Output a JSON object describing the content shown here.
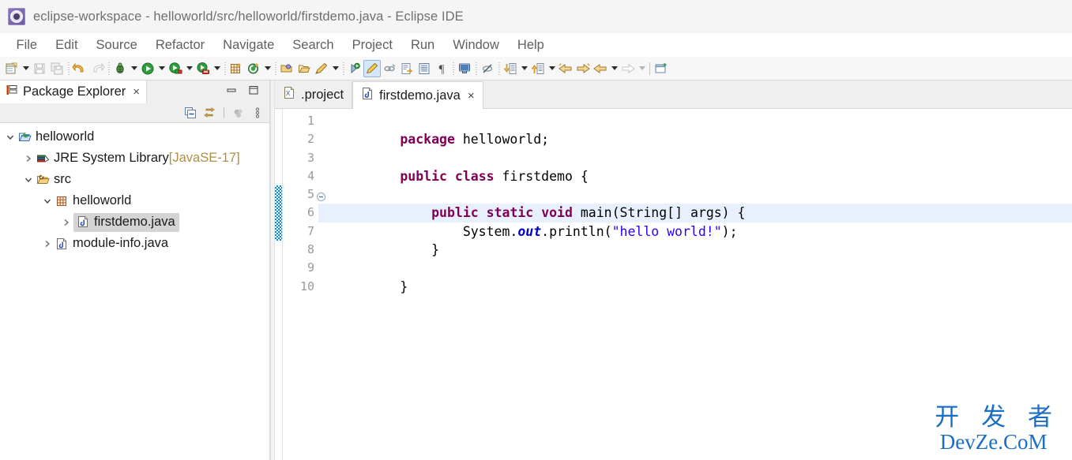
{
  "window": {
    "title": "eclipse-workspace - helloworld/src/helloworld/firstdemo.java - Eclipse IDE",
    "app_icon": "eclipse-icon"
  },
  "menubar": {
    "items": [
      {
        "label": "File"
      },
      {
        "label": "Edit"
      },
      {
        "label": "Source"
      },
      {
        "label": "Refactor"
      },
      {
        "label": "Navigate"
      },
      {
        "label": "Search"
      },
      {
        "label": "Project"
      },
      {
        "label": "Run"
      },
      {
        "label": "Window"
      },
      {
        "label": "Help"
      }
    ]
  },
  "toolbar": {
    "items": [
      {
        "icon": "new-wizard-icon"
      },
      {
        "icon": "dropdown-arrow-icon"
      },
      {
        "icon": "save-icon"
      },
      {
        "icon": "save-all-icon"
      },
      {
        "icon": "separator"
      },
      {
        "icon": "undo-icon"
      },
      {
        "icon": "redo-icon"
      },
      {
        "icon": "separator"
      },
      {
        "icon": "debug-icon"
      },
      {
        "icon": "dropdown-arrow-icon"
      },
      {
        "icon": "run-icon"
      },
      {
        "icon": "dropdown-arrow-icon"
      },
      {
        "icon": "coverage-icon"
      },
      {
        "icon": "dropdown-arrow-icon"
      },
      {
        "icon": "run-external-tools-icon"
      },
      {
        "icon": "dropdown-arrow-icon"
      },
      {
        "icon": "separator"
      },
      {
        "icon": "new-java-project-icon"
      },
      {
        "icon": "new-java-class-icon"
      },
      {
        "icon": "dropdown-arrow-icon"
      },
      {
        "icon": "separator"
      },
      {
        "icon": "open-type-icon"
      },
      {
        "icon": "open-task-icon"
      },
      {
        "icon": "search-icon"
      },
      {
        "icon": "dropdown-arrow-icon"
      },
      {
        "icon": "separator"
      },
      {
        "icon": "skip-breakpoints-icon"
      },
      {
        "icon": "toggle-mark-occurrences-icon"
      },
      {
        "icon": "link-icon"
      },
      {
        "icon": "open-declaration-icon"
      },
      {
        "icon": "show-outline-icon"
      },
      {
        "icon": "show-whitespace-icon"
      },
      {
        "icon": "separator"
      },
      {
        "icon": "console-icon"
      },
      {
        "icon": "separator"
      },
      {
        "icon": "no-annotations-icon"
      },
      {
        "icon": "separator"
      },
      {
        "icon": "next-annotation-icon"
      },
      {
        "icon": "dropdown-arrow-icon"
      },
      {
        "icon": "previous-annotation-icon"
      },
      {
        "icon": "dropdown-arrow-icon"
      },
      {
        "icon": "back-history-icon"
      },
      {
        "icon": "forward-history-icon"
      },
      {
        "icon": "back-icon"
      },
      {
        "icon": "dropdown-arrow-icon"
      },
      {
        "icon": "forward-icon"
      },
      {
        "icon": "dropdown-arrow-icon"
      },
      {
        "icon": "separator-solid"
      },
      {
        "icon": "new-window-icon"
      }
    ]
  },
  "package_explorer": {
    "tab_label": "Package Explorer",
    "close_glyph": "×",
    "window_buttons": [
      {
        "name": "minimize-button",
        "glyph": "minimize"
      },
      {
        "name": "maximize-button",
        "glyph": "maximize"
      }
    ],
    "view_tools": [
      {
        "name": "collapse-all-icon"
      },
      {
        "name": "link-with-editor-icon"
      },
      {
        "name": "separator"
      },
      {
        "name": "focus-active-task-icon"
      },
      {
        "name": "view-menu-icon"
      }
    ],
    "tree": [
      {
        "indent": 0,
        "twisty": "expanded",
        "icon": "java-project-icon",
        "label": "helloworld",
        "suffix": "",
        "selected": false
      },
      {
        "indent": 1,
        "twisty": "collapsed",
        "icon": "jre-library-icon",
        "label": "JRE System Library",
        "suffix": " [JavaSE-17]",
        "selected": false
      },
      {
        "indent": 1,
        "twisty": "expanded",
        "icon": "source-folder-icon",
        "label": "src",
        "suffix": "",
        "selected": false
      },
      {
        "indent": 2,
        "twisty": "expanded",
        "icon": "package-icon",
        "label": "helloworld",
        "suffix": "",
        "selected": false
      },
      {
        "indent": 3,
        "twisty": "collapsed",
        "icon": "java-file-icon",
        "label": "firstdemo.java",
        "suffix": "",
        "selected": true
      },
      {
        "indent": 2,
        "twisty": "collapsed",
        "icon": "java-file-icon",
        "label": "module-info.java",
        "suffix": "",
        "selected": false
      }
    ]
  },
  "editor": {
    "tabs": [
      {
        "label": ".project",
        "icon": "xml-file-icon",
        "active": false,
        "closable": false
      },
      {
        "label": "firstdemo.java",
        "icon": "java-file-icon",
        "active": true,
        "closable": true,
        "close_glyph": "×"
      }
    ],
    "gutter": [
      "1",
      "2",
      "3",
      "4",
      "5",
      "6",
      "7",
      "8",
      "9",
      "10"
    ],
    "fold_marker_line": 5,
    "change_bar_lines": [
      5,
      7
    ],
    "highlight_line": 6,
    "lines": [
      {
        "n": 1,
        "tokens": [
          {
            "t": "package",
            "c": "kw"
          },
          {
            "t": " helloworld;",
            "c": ""
          }
        ]
      },
      {
        "n": 2,
        "tokens": [
          {
            "t": "",
            "c": ""
          }
        ]
      },
      {
        "n": 3,
        "tokens": [
          {
            "t": "public",
            "c": "kw"
          },
          {
            "t": " ",
            "c": ""
          },
          {
            "t": "class",
            "c": "kw"
          },
          {
            "t": " firstdemo {",
            "c": ""
          }
        ]
      },
      {
        "n": 4,
        "tokens": [
          {
            "t": "",
            "c": ""
          }
        ]
      },
      {
        "n": 5,
        "tokens": [
          {
            "t": "    ",
            "c": ""
          },
          {
            "t": "public",
            "c": "kw"
          },
          {
            "t": " ",
            "c": ""
          },
          {
            "t": "static",
            "c": "kw"
          },
          {
            "t": " ",
            "c": ""
          },
          {
            "t": "void",
            "c": "kw"
          },
          {
            "t": " main(String[] args) {",
            "c": ""
          }
        ]
      },
      {
        "n": 6,
        "tokens": [
          {
            "t": "        System.",
            "c": ""
          },
          {
            "t": "out",
            "c": "fld"
          },
          {
            "t": ".println(",
            "c": ""
          },
          {
            "t": "\"hello world!\"",
            "c": "str"
          },
          {
            "t": ");",
            "c": ""
          }
        ]
      },
      {
        "n": 7,
        "tokens": [
          {
            "t": "    }",
            "c": ""
          }
        ]
      },
      {
        "n": 8,
        "tokens": [
          {
            "t": "",
            "c": ""
          }
        ]
      },
      {
        "n": 9,
        "tokens": [
          {
            "t": "}",
            "c": ""
          }
        ]
      },
      {
        "n": 10,
        "tokens": [
          {
            "t": "",
            "c": ""
          }
        ]
      }
    ]
  },
  "watermark": {
    "chinese": "开 发 者",
    "latin": "DevZe.CoM",
    "color": "#1a6fc4"
  },
  "colors": {
    "keyword": "#7f0055",
    "string": "#2a00ff",
    "field": "#0000c0",
    "line_highlight": "#e8f0fd",
    "change_bar": "#0a8ad6",
    "selection": "#d4d4d4",
    "titlebar_bg": "#f5f5f5",
    "toolbar_bg": "#f7f7f7"
  }
}
